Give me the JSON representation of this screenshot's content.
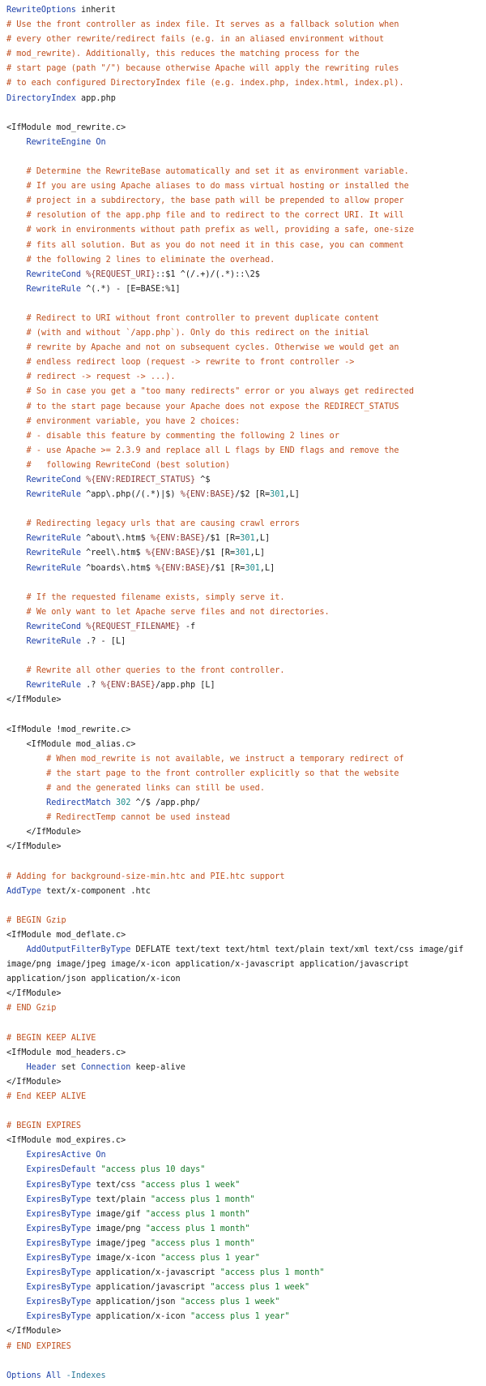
{
  "lines": [
    [
      [
        "k",
        "RewriteOptions"
      ],
      [
        "v",
        " inherit"
      ]
    ],
    [
      [
        "c",
        "# Use the front controller as index file. It serves as a fallback solution when"
      ]
    ],
    [
      [
        "c",
        "# every other rewrite/redirect fails (e.g. in an aliased environment without"
      ]
    ],
    [
      [
        "c",
        "# mod_rewrite). Additionally, this reduces the matching process for the"
      ]
    ],
    [
      [
        "c",
        "# start page (path \"/\") because otherwise Apache will apply the rewriting rules"
      ]
    ],
    [
      [
        "c",
        "# to each configured DirectoryIndex file (e.g. index.php, index.html, index.pl)."
      ]
    ],
    [
      [
        "k",
        "DirectoryIndex"
      ],
      [
        "v",
        " app.php"
      ]
    ],
    [],
    [
      [
        "t",
        "<IfModule mod_rewrite.c>"
      ]
    ],
    [
      [
        "v",
        "    "
      ],
      [
        "k",
        "RewriteEngine"
      ],
      [
        "v",
        " "
      ],
      [
        "k",
        "On"
      ]
    ],
    [],
    [
      [
        "v",
        "    "
      ],
      [
        "c",
        "# Determine the RewriteBase automatically and set it as environment variable."
      ]
    ],
    [
      [
        "v",
        "    "
      ],
      [
        "c",
        "# If you are using Apache aliases to do mass virtual hosting or installed the"
      ]
    ],
    [
      [
        "v",
        "    "
      ],
      [
        "c",
        "# project in a subdirectory, the base path will be prepended to allow proper"
      ]
    ],
    [
      [
        "v",
        "    "
      ],
      [
        "c",
        "# resolution of the app.php file and to redirect to the correct URI. It will"
      ]
    ],
    [
      [
        "v",
        "    "
      ],
      [
        "c",
        "# work in environments without path prefix as well, providing a safe, one-size"
      ]
    ],
    [
      [
        "v",
        "    "
      ],
      [
        "c",
        "# fits all solution. But as you do not need it in this case, you can comment"
      ]
    ],
    [
      [
        "v",
        "    "
      ],
      [
        "c",
        "# the following 2 lines to eliminate the overhead."
      ]
    ],
    [
      [
        "v",
        "    "
      ],
      [
        "k",
        "RewriteCond"
      ],
      [
        "v",
        " "
      ],
      [
        "var",
        "%{REQUEST_URI}"
      ],
      [
        "v",
        "::$1 ^(/.+)/(.*)::\\2$"
      ]
    ],
    [
      [
        "v",
        "    "
      ],
      [
        "k",
        "RewriteRule"
      ],
      [
        "v",
        " ^(.*) - [E=BASE:%1]"
      ]
    ],
    [],
    [
      [
        "v",
        "    "
      ],
      [
        "c",
        "# Redirect to URI without front controller to prevent duplicate content"
      ]
    ],
    [
      [
        "v",
        "    "
      ],
      [
        "c",
        "# (with and without `/app.php`). Only do this redirect on the initial"
      ]
    ],
    [
      [
        "v",
        "    "
      ],
      [
        "c",
        "# rewrite by Apache and not on subsequent cycles. Otherwise we would get an"
      ]
    ],
    [
      [
        "v",
        "    "
      ],
      [
        "c",
        "# endless redirect loop (request -> rewrite to front controller ->"
      ]
    ],
    [
      [
        "v",
        "    "
      ],
      [
        "c",
        "# redirect -> request -> ...)."
      ]
    ],
    [
      [
        "v",
        "    "
      ],
      [
        "c",
        "# So in case you get a \"too many redirects\" error or you always get redirected"
      ]
    ],
    [
      [
        "v",
        "    "
      ],
      [
        "c",
        "# to the start page because your Apache does not expose the REDIRECT_STATUS"
      ]
    ],
    [
      [
        "v",
        "    "
      ],
      [
        "c",
        "# environment variable, you have 2 choices:"
      ]
    ],
    [
      [
        "v",
        "    "
      ],
      [
        "c",
        "# - disable this feature by commenting the following 2 lines or"
      ]
    ],
    [
      [
        "v",
        "    "
      ],
      [
        "c",
        "# - use Apache >= 2.3.9 and replace all L flags by END flags and remove the"
      ]
    ],
    [
      [
        "v",
        "    "
      ],
      [
        "c",
        "#   following RewriteCond (best solution)"
      ]
    ],
    [
      [
        "v",
        "    "
      ],
      [
        "k",
        "RewriteCond"
      ],
      [
        "v",
        " "
      ],
      [
        "var",
        "%{ENV:REDIRECT_STATUS}"
      ],
      [
        "v",
        " ^$"
      ]
    ],
    [
      [
        "v",
        "    "
      ],
      [
        "k",
        "RewriteRule"
      ],
      [
        "v",
        " ^app\\.php(/(.*)|$) "
      ],
      [
        "var",
        "%{ENV:BASE}"
      ],
      [
        "v",
        "/$2 [R="
      ],
      [
        "n",
        "301"
      ],
      [
        "v",
        ",L]"
      ]
    ],
    [],
    [
      [
        "v",
        "    "
      ],
      [
        "c",
        "# Redirecting legacy urls that are causing crawl errors"
      ]
    ],
    [
      [
        "v",
        "    "
      ],
      [
        "k",
        "RewriteRule"
      ],
      [
        "v",
        " ^about\\.htm$ "
      ],
      [
        "var",
        "%{ENV:BASE}"
      ],
      [
        "v",
        "/$1 [R="
      ],
      [
        "n",
        "301"
      ],
      [
        "v",
        ",L]"
      ]
    ],
    [
      [
        "v",
        "    "
      ],
      [
        "k",
        "RewriteRule"
      ],
      [
        "v",
        " ^reel\\.htm$ "
      ],
      [
        "var",
        "%{ENV:BASE}"
      ],
      [
        "v",
        "/$1 [R="
      ],
      [
        "n",
        "301"
      ],
      [
        "v",
        ",L]"
      ]
    ],
    [
      [
        "v",
        "    "
      ],
      [
        "k",
        "RewriteRule"
      ],
      [
        "v",
        " ^boards\\.htm$ "
      ],
      [
        "var",
        "%{ENV:BASE}"
      ],
      [
        "v",
        "/$1 [R="
      ],
      [
        "n",
        "301"
      ],
      [
        "v",
        ",L]"
      ]
    ],
    [],
    [
      [
        "v",
        "    "
      ],
      [
        "c",
        "# If the requested filename exists, simply serve it."
      ]
    ],
    [
      [
        "v",
        "    "
      ],
      [
        "c",
        "# We only want to let Apache serve files and not directories."
      ]
    ],
    [
      [
        "v",
        "    "
      ],
      [
        "k",
        "RewriteCond"
      ],
      [
        "v",
        " "
      ],
      [
        "var",
        "%{REQUEST_FILENAME}"
      ],
      [
        "v",
        " -f"
      ]
    ],
    [
      [
        "v",
        "    "
      ],
      [
        "k",
        "RewriteRule"
      ],
      [
        "v",
        " .? - [L]"
      ]
    ],
    [],
    [
      [
        "v",
        "    "
      ],
      [
        "c",
        "# Rewrite all other queries to the front controller."
      ]
    ],
    [
      [
        "v",
        "    "
      ],
      [
        "k",
        "RewriteRule"
      ],
      [
        "v",
        " .? "
      ],
      [
        "var",
        "%{ENV:BASE}"
      ],
      [
        "v",
        "/app.php [L]"
      ]
    ],
    [
      [
        "t",
        "</IfModule>"
      ]
    ],
    [],
    [
      [
        "t",
        "<IfModule !mod_rewrite.c>"
      ]
    ],
    [
      [
        "v",
        "    "
      ],
      [
        "t",
        "<IfModule mod_alias.c>"
      ]
    ],
    [
      [
        "v",
        "        "
      ],
      [
        "c",
        "# When mod_rewrite is not available, we instruct a temporary redirect of"
      ]
    ],
    [
      [
        "v",
        "        "
      ],
      [
        "c",
        "# the start page to the front controller explicitly so that the website"
      ]
    ],
    [
      [
        "v",
        "        "
      ],
      [
        "c",
        "# and the generated links can still be used."
      ]
    ],
    [
      [
        "v",
        "        "
      ],
      [
        "k",
        "RedirectMatch"
      ],
      [
        "v",
        " "
      ],
      [
        "n",
        "302"
      ],
      [
        "v",
        " ^/$ /app.php/"
      ]
    ],
    [
      [
        "v",
        "        "
      ],
      [
        "c",
        "# RedirectTemp cannot be used instead"
      ]
    ],
    [
      [
        "v",
        "    "
      ],
      [
        "t",
        "</IfModule>"
      ]
    ],
    [
      [
        "t",
        "</IfModule>"
      ]
    ],
    [],
    [
      [
        "c",
        "# Adding for background-size-min.htc and PIE.htc support"
      ]
    ],
    [
      [
        "k",
        "AddType"
      ],
      [
        "v",
        " text/x-component .htc"
      ]
    ],
    [],
    [
      [
        "c",
        "# BEGIN Gzip"
      ]
    ],
    [
      [
        "t",
        "<IfModule mod_deflate.c>"
      ]
    ],
    [
      [
        "v",
        "    "
      ],
      [
        "k",
        "AddOutputFilterByType"
      ],
      [
        "v",
        " DEFLATE text/text text/html text/plain text/xml text/css image/gif"
      ]
    ],
    [
      [
        "v",
        "image/png image/jpeg image/x-icon application/x-javascript application/javascript"
      ]
    ],
    [
      [
        "v",
        "application/json application/x-icon"
      ]
    ],
    [
      [
        "t",
        "</IfModule>"
      ]
    ],
    [
      [
        "c",
        "# END Gzip"
      ]
    ],
    [],
    [
      [
        "c",
        "# BEGIN KEEP ALIVE"
      ]
    ],
    [
      [
        "t",
        "<IfModule mod_headers.c>"
      ]
    ],
    [
      [
        "v",
        "    "
      ],
      [
        "k",
        "Header"
      ],
      [
        "v",
        " set "
      ],
      [
        "k",
        "Connection"
      ],
      [
        "v",
        " keep-alive"
      ]
    ],
    [
      [
        "t",
        "</IfModule>"
      ]
    ],
    [
      [
        "c",
        "# End KEEP ALIVE"
      ]
    ],
    [],
    [
      [
        "c",
        "# BEGIN EXPIRES"
      ]
    ],
    [
      [
        "t",
        "<IfModule mod_expires.c>"
      ]
    ],
    [
      [
        "v",
        "    "
      ],
      [
        "k",
        "ExpiresActive"
      ],
      [
        "v",
        " "
      ],
      [
        "k",
        "On"
      ]
    ],
    [
      [
        "v",
        "    "
      ],
      [
        "k",
        "ExpiresDefault"
      ],
      [
        "v",
        " "
      ],
      [
        "s",
        "\"access plus 10 days\""
      ]
    ],
    [
      [
        "v",
        "    "
      ],
      [
        "k",
        "ExpiresByType"
      ],
      [
        "v",
        " text/css "
      ],
      [
        "s",
        "\"access plus 1 week\""
      ]
    ],
    [
      [
        "v",
        "    "
      ],
      [
        "k",
        "ExpiresByType"
      ],
      [
        "v",
        " text/plain "
      ],
      [
        "s",
        "\"access plus 1 month\""
      ]
    ],
    [
      [
        "v",
        "    "
      ],
      [
        "k",
        "ExpiresByType"
      ],
      [
        "v",
        " image/gif "
      ],
      [
        "s",
        "\"access plus 1 month\""
      ]
    ],
    [
      [
        "v",
        "    "
      ],
      [
        "k",
        "ExpiresByType"
      ],
      [
        "v",
        " image/png "
      ],
      [
        "s",
        "\"access plus 1 month\""
      ]
    ],
    [
      [
        "v",
        "    "
      ],
      [
        "k",
        "ExpiresByType"
      ],
      [
        "v",
        " image/jpeg "
      ],
      [
        "s",
        "\"access plus 1 month\""
      ]
    ],
    [
      [
        "v",
        "    "
      ],
      [
        "k",
        "ExpiresByType"
      ],
      [
        "v",
        " image/x-icon "
      ],
      [
        "s",
        "\"access plus 1 year\""
      ]
    ],
    [
      [
        "v",
        "    "
      ],
      [
        "k",
        "ExpiresByType"
      ],
      [
        "v",
        " application/x-javascript "
      ],
      [
        "s",
        "\"access plus 1 month\""
      ]
    ],
    [
      [
        "v",
        "    "
      ],
      [
        "k",
        "ExpiresByType"
      ],
      [
        "v",
        " application/javascript "
      ],
      [
        "s",
        "\"access plus 1 week\""
      ]
    ],
    [
      [
        "v",
        "    "
      ],
      [
        "k",
        "ExpiresByType"
      ],
      [
        "v",
        " application/json "
      ],
      [
        "s",
        "\"access plus 1 week\""
      ]
    ],
    [
      [
        "v",
        "    "
      ],
      [
        "k",
        "ExpiresByType"
      ],
      [
        "v",
        " application/x-icon "
      ],
      [
        "s",
        "\"access plus 1 year\""
      ]
    ],
    [
      [
        "t",
        "</IfModule>"
      ]
    ],
    [
      [
        "c",
        "# END EXPIRES"
      ]
    ],
    [],
    [
      [
        "k",
        "Options"
      ],
      [
        "v",
        " "
      ],
      [
        "k",
        "All"
      ],
      [
        "v",
        " "
      ],
      [
        "f",
        "-Indexes"
      ]
    ]
  ]
}
